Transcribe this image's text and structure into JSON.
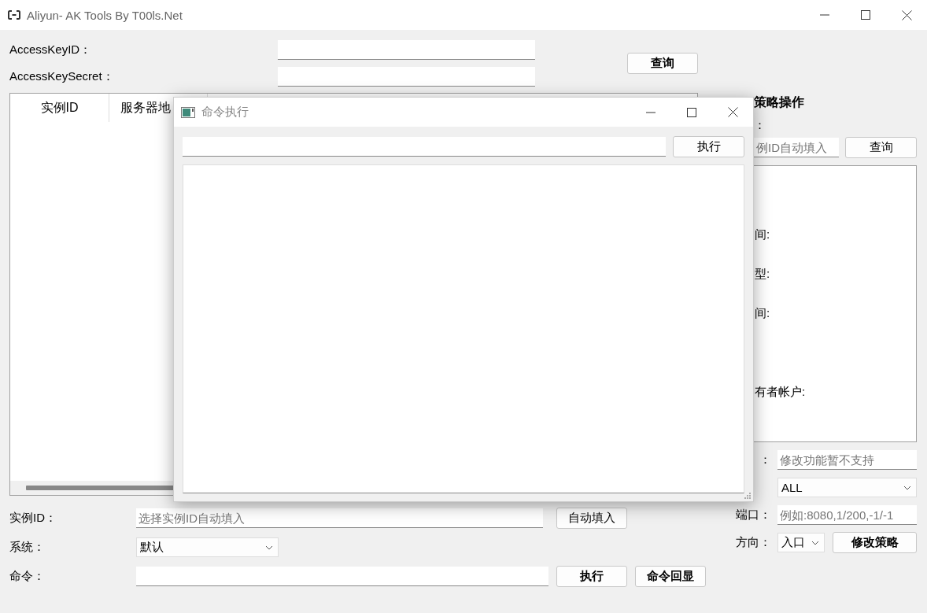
{
  "window": {
    "title": "Aliyun- AK Tools By T00ls.Net"
  },
  "credentials": [
    {
      "label": "AccessKeyID："
    },
    {
      "label": "AccessKeySecret："
    }
  ],
  "query_button": "查询",
  "table": {
    "columns": [
      "实例ID",
      "服务器地"
    ]
  },
  "instance_form": {
    "instance_label": "实例ID：",
    "instance_placeholder": "选择实例ID自动填入",
    "autofill_button": "自动填入",
    "system_label": "系统：",
    "system_value": "默认",
    "command_label": "命令：",
    "execute_button": "执行",
    "echo_button": "命令回显"
  },
  "security_panel": {
    "heading": "策略操作",
    "group_label": "：",
    "search_placeholder": "例ID自动填入",
    "search_button": "查询",
    "info_labels": [
      "间:",
      "型:",
      "间:",
      "有者帐户:"
    ],
    "name_label": "：",
    "name_placeholder": "修改功能暂不支持",
    "protocol_value": "ALL",
    "port_label": "端口：",
    "port_placeholder": "例如:8080,1/200,-1/-1",
    "direction_label": "方向：",
    "direction_value": "入口",
    "modify_button": "修改策略"
  },
  "dialog": {
    "title": "命令执行",
    "run_button": "执行"
  }
}
